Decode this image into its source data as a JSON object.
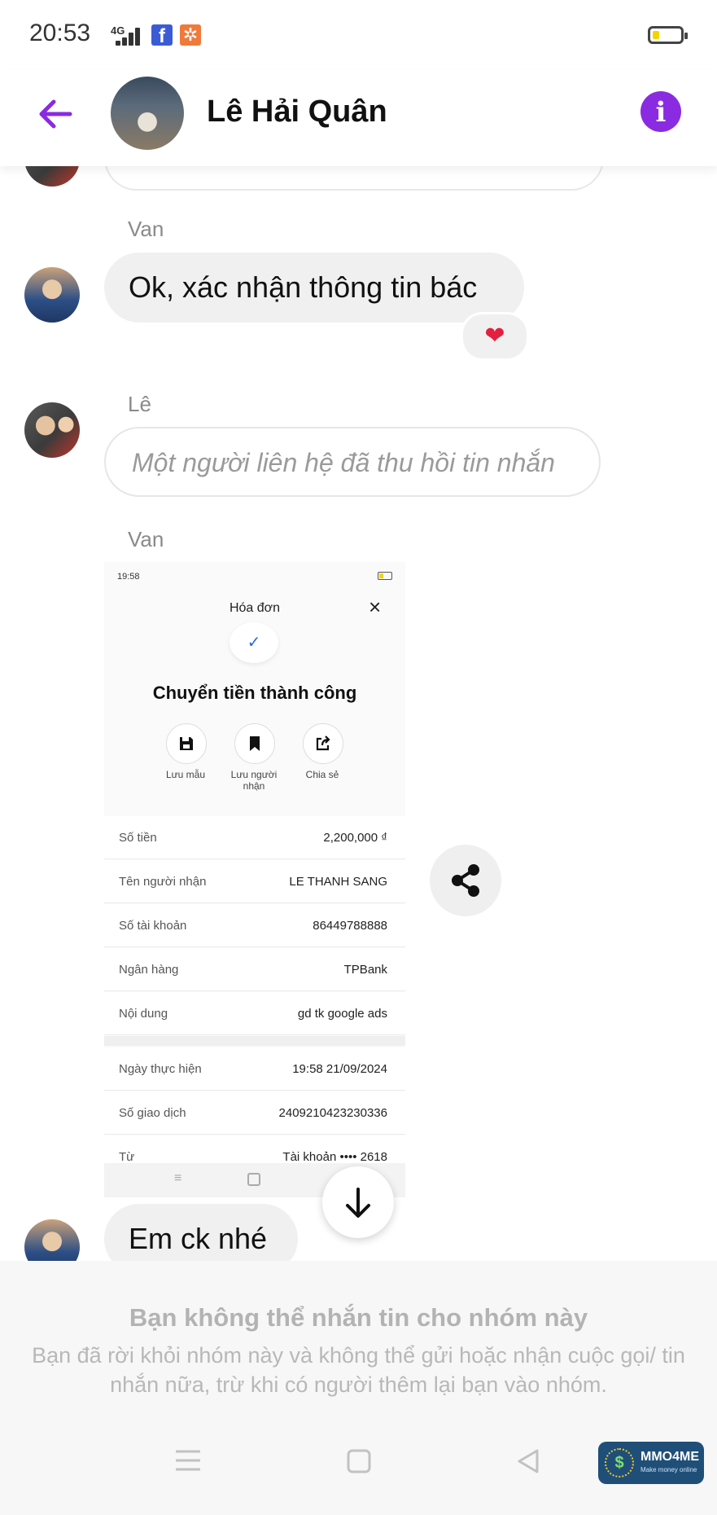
{
  "status_bar": {
    "time": "20:53",
    "network": "4G"
  },
  "header": {
    "title": "Lê Hải Quân"
  },
  "messages": {
    "sender_van_1": "Van",
    "msg_ok": "Ok, xác nhận thông tin bác",
    "reaction": "❤",
    "sender_le": "Lê",
    "recalled": "Một người liên hệ đã thu hồi tin nhắn",
    "sender_van_2": "Van",
    "msg_ck": "Em ck nhé"
  },
  "receipt": {
    "status_time": "19:58",
    "title": "Hóa đơn",
    "success": "Chuyển tiền thành công",
    "actions": [
      "Lưu mẫu",
      "Lưu người nhận",
      "Chia sẻ"
    ],
    "rows": [
      {
        "label": "Số tiền",
        "value": "2,200,000 ₫"
      },
      {
        "label": "Tên người nhận",
        "value": "LE THANH SANG"
      },
      {
        "label": "Số tài khoản",
        "value": "86449788888"
      },
      {
        "label": "Ngân hàng",
        "value": "TPBank"
      },
      {
        "label": "Nội dung",
        "value": "gd tk google ads"
      },
      {
        "label": "Ngày thực hiện",
        "value": "19:58 21/09/2024"
      },
      {
        "label": "Số giao dịch",
        "value": "2409210423230336"
      },
      {
        "label": "Từ",
        "value": "Tài khoản •••• 2618"
      }
    ]
  },
  "footer": {
    "title": "Bạn không thể nhắn tin cho nhóm này",
    "body": "Bạn đã rời khỏi nhóm này và không thể gửi hoặc nhận cuộc gọi/ tin nhắn nữa, trừ khi có người thêm lại bạn vào nhóm."
  },
  "watermark": {
    "name": "MMO4ME",
    "tagline": "Make money online"
  },
  "colors": {
    "accent": "#8a2be2",
    "bubble": "#f0f0f0",
    "heart": "#e41e3f"
  }
}
